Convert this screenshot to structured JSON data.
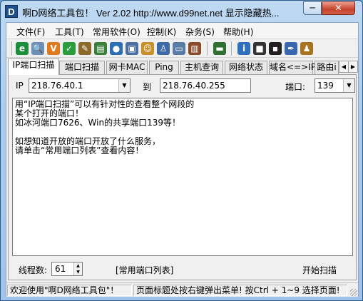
{
  "window": {
    "app_icon": "D",
    "title": "啊D网络工具包！ Ver 2.02  http://www.d99net.net  显示隐藏热...",
    "minimize": "─",
    "close": "✕"
  },
  "menu": [
    {
      "label": "文件(F)"
    },
    {
      "label": "工具(T)"
    },
    {
      "label": "常用软件(O)"
    },
    {
      "label": "控制(K)"
    },
    {
      "label": "杂务(S)"
    },
    {
      "label": "帮助(H)"
    }
  ],
  "toolbar": [
    {
      "icon": "ie-globe-icon",
      "glyph": "e",
      "color": "#1c8d3a"
    },
    {
      "icon": "magnifier-icon",
      "glyph": "🔍",
      "color": "#6b8fb7"
    },
    {
      "icon": "v-logo-icon",
      "glyph": "V",
      "color": "#e07a1f"
    },
    {
      "icon": "checkmark-icon",
      "glyph": "✓",
      "color": "#2a9d3c"
    },
    {
      "icon": "tools-icon",
      "glyph": "✎",
      "color": "#8c6a2a"
    },
    {
      "icon": "chart-icon",
      "glyph": "▤",
      "color": "#3b7f3b"
    },
    {
      "icon": "world-icon",
      "glyph": "●",
      "color": "#2c6fb7"
    },
    {
      "icon": "network-pc-icon",
      "glyph": "▣",
      "color": "#4a6fa0"
    },
    {
      "icon": "users-icon",
      "glyph": "☺",
      "color": "#c9902a"
    },
    {
      "icon": "search-user-icon",
      "glyph": "♙",
      "color": "#3e6aa8"
    },
    {
      "icon": "computers-icon",
      "glyph": "▭",
      "color": "#5a7da8"
    },
    {
      "icon": "monitor-icon",
      "glyph": "▥",
      "color": "#8a4b2a"
    },
    {
      "icon": "terminal-icon",
      "glyph": "▬",
      "color": "#2f6f2f"
    },
    {
      "icon": "info-icon",
      "glyph": "i",
      "color": "#2f6fc0"
    },
    {
      "icon": "screen-icon",
      "glyph": "■",
      "color": "#333333"
    },
    {
      "icon": "console-icon",
      "glyph": "▪",
      "color": "#202020"
    },
    {
      "icon": "pen-icon",
      "glyph": "✒",
      "color": "#3a66b0"
    },
    {
      "icon": "people-icon",
      "glyph": "♟",
      "color": "#a8741f"
    }
  ],
  "tabs": [
    {
      "label": "IP端口扫描",
      "active": true
    },
    {
      "label": "端口扫描"
    },
    {
      "label": "网卡MAC"
    },
    {
      "label": "Ping"
    },
    {
      "label": "主机查询"
    },
    {
      "label": "网络状态"
    },
    {
      "label": "域名<=>IP"
    },
    {
      "label": "路由i"
    }
  ],
  "scan": {
    "ip_label": "IP",
    "ip_from": "218.76.40.1",
    "to_label": "到",
    "ip_to": "218.76.40.255",
    "port_label": "端口:",
    "port": "139",
    "output_lines": [
      "用“IP端口扫描”可以有针对性的查看整个网段的",
      "某个打开的端口！",
      "如冰河端口7626、Win的共享端口139等！",
      "",
      "如想知道开放的端口开放了什么服务，",
      "请单击“常用端口列表”查看内容！"
    ],
    "threads_label": "线程数:",
    "threads": "61",
    "port_list_link": "[常用端口列表]",
    "start_button": "开始扫描"
  },
  "status": {
    "left": "欢迎使用\"啊D网络工具包\"！",
    "right": "页面标题处按右键弹出菜单! 按Ctrl + 1~9  选择页面!"
  }
}
